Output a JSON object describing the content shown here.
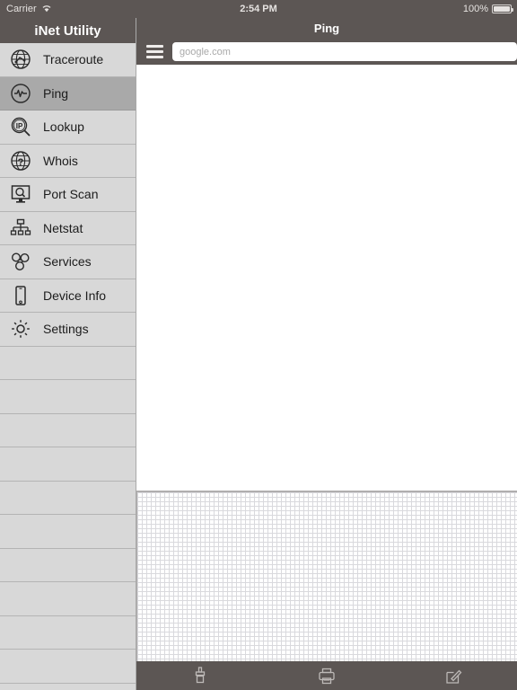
{
  "status_bar": {
    "carrier": "Carrier",
    "wifi_icon": "wifi-icon",
    "time": "2:54 PM",
    "battery_percent": "100%",
    "battery_icon": "battery-full-icon"
  },
  "sidebar": {
    "title": "iNet Utility",
    "selected_index": 1,
    "filler_row_count": 10,
    "items": [
      {
        "label": "Traceroute",
        "icon": "globe-route-icon",
        "selected": false
      },
      {
        "label": "Ping",
        "icon": "pulse-circle-icon",
        "selected": true
      },
      {
        "label": "Lookup",
        "icon": "ip-magnifier-icon",
        "selected": false
      },
      {
        "label": "Whois",
        "icon": "globe-question-icon",
        "selected": false
      },
      {
        "label": "Port Scan",
        "icon": "monitor-magnifier-icon",
        "selected": false
      },
      {
        "label": "Netstat",
        "icon": "network-tree-icon",
        "selected": false
      },
      {
        "label": "Services",
        "icon": "bonjour-cluster-icon",
        "selected": false
      },
      {
        "label": "Device Info",
        "icon": "phone-icon",
        "selected": false
      },
      {
        "label": "Settings",
        "icon": "gear-icon",
        "selected": false
      }
    ]
  },
  "main": {
    "nav_title": "Ping",
    "menu_icon": "hamburger-icon",
    "address_value": "",
    "address_placeholder": "google.com",
    "output_text": "",
    "bottom_toolbar": [
      {
        "label": "Clear",
        "icon": "brush-icon"
      },
      {
        "label": "Print",
        "icon": "printer-icon"
      },
      {
        "label": "Compose",
        "icon": "compose-icon"
      }
    ]
  },
  "colors": {
    "chrome": "#5c5654",
    "sidebar_bg": "#d8d8d8",
    "sidebar_selected": "#a9a9a9",
    "separator": "#b4b4b4",
    "grid_line": "#d9d9dd",
    "placeholder": "#a9a9a9"
  }
}
